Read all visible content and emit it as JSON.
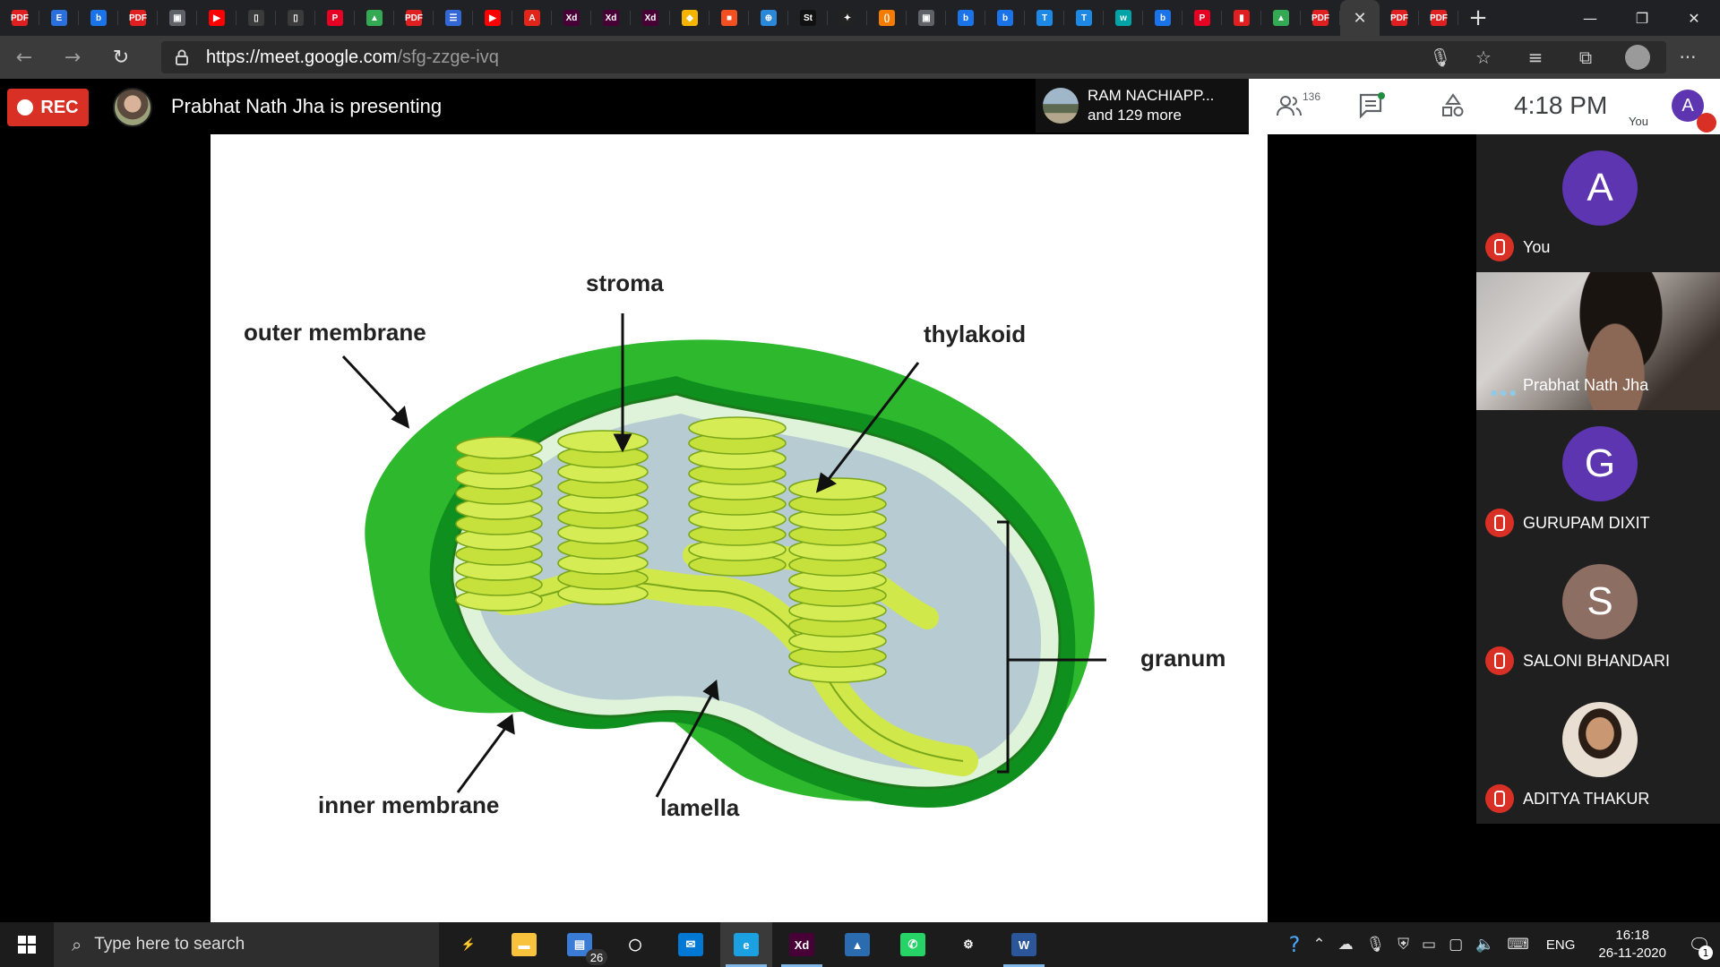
{
  "browser": {
    "tab_favicons": [
      {
        "icon": "pdf-icon",
        "color": "#e02020",
        "glyph": "PDF"
      },
      {
        "icon": "edge-e-icon",
        "color": "#2a6fdb",
        "glyph": "E"
      },
      {
        "icon": "bing-icon",
        "color": "#1a73e8",
        "glyph": "b"
      },
      {
        "icon": "pdf-icon",
        "color": "#e02020",
        "glyph": "PDF"
      },
      {
        "icon": "contact-card-icon",
        "color": "#5f6368",
        "glyph": "▣"
      },
      {
        "icon": "youtube-icon",
        "color": "#ff0000",
        "glyph": "▶"
      },
      {
        "icon": "document-icon",
        "color": "#3b3b3b",
        "glyph": "▯"
      },
      {
        "icon": "document-icon",
        "color": "#3b3b3b",
        "glyph": "▯"
      },
      {
        "icon": "pinterest-icon",
        "color": "#e60023",
        "glyph": "P"
      },
      {
        "icon": "google-drive-icon",
        "color": "#34a853",
        "glyph": "▲"
      },
      {
        "icon": "pdf-icon",
        "color": "#e02020",
        "glyph": "PDF"
      },
      {
        "icon": "forms-icon",
        "color": "#3367d6",
        "glyph": "☰"
      },
      {
        "icon": "youtube-icon",
        "color": "#ff0000",
        "glyph": "▶"
      },
      {
        "icon": "adobe-icon",
        "color": "#e1251b",
        "glyph": "A"
      },
      {
        "icon": "adobe-xd-icon",
        "color": "#470137",
        "glyph": "Xd"
      },
      {
        "icon": "adobe-xd-icon",
        "color": "#470137",
        "glyph": "Xd"
      },
      {
        "icon": "adobe-xd-icon",
        "color": "#470137",
        "glyph": "Xd"
      },
      {
        "icon": "layers-icon",
        "color": "#f4b400",
        "glyph": "◆"
      },
      {
        "icon": "microsoft-icon",
        "color": "#f25022",
        "glyph": "■"
      },
      {
        "icon": "teams-icon",
        "color": "#2b88d8",
        "glyph": "⊕"
      },
      {
        "icon": "st-icon",
        "color": "#111111",
        "glyph": "St"
      },
      {
        "icon": "spark-icon",
        "color": "#222222",
        "glyph": "✦"
      },
      {
        "icon": "script-icon",
        "color": "#f57c00",
        "glyph": "()"
      },
      {
        "icon": "contact-card-icon",
        "color": "#5f6368",
        "glyph": "▣"
      },
      {
        "icon": "bing-icon",
        "color": "#1a73e8",
        "glyph": "b"
      },
      {
        "icon": "bing-icon",
        "color": "#1a73e8",
        "glyph": "b"
      },
      {
        "icon": "tez-icon",
        "color": "#1e88e5",
        "glyph": "T"
      },
      {
        "icon": "tez-icon",
        "color": "#1e88e5",
        "glyph": "T"
      },
      {
        "icon": "w-icon",
        "color": "#00a4a6",
        "glyph": "w"
      },
      {
        "icon": "bing-icon",
        "color": "#1a73e8",
        "glyph": "b"
      },
      {
        "icon": "pinterest-icon",
        "color": "#e60023",
        "glyph": "P"
      },
      {
        "icon": "pdf-icon",
        "color": "#e02020",
        "glyph": "▮"
      },
      {
        "icon": "google-drive-icon",
        "color": "#34a853",
        "glyph": "▲"
      },
      {
        "icon": "pdf-icon",
        "color": "#e02020",
        "glyph": "PDF"
      }
    ],
    "tab_favicons_after": [
      {
        "icon": "pdf-icon",
        "color": "#e02020",
        "glyph": "PDF"
      },
      {
        "icon": "pdf-icon",
        "color": "#e02020",
        "glyph": "PDF"
      }
    ],
    "active_tab_close": "✕",
    "new_tab_glyph": "+",
    "window_controls": {
      "minimize": "—",
      "restore": "❐",
      "close": "✕"
    },
    "url": {
      "host": "https://meet.google.com",
      "path": "/sfg-zzge-ivq"
    }
  },
  "meet": {
    "rec_label": "REC",
    "presenting_text": "Prabhat Nath Jha is presenting",
    "participant_chip": {
      "line1": "RAM NACHIAPP...",
      "line2": "and 129 more"
    },
    "people_count": "136",
    "clock": "4:18 PM",
    "you_initial": "A",
    "you_label": "You",
    "accent_color": "#5e35b1",
    "rec_color": "#d93025"
  },
  "slide": {
    "labels": {
      "stroma": "stroma",
      "outer_membrane": "outer membrane",
      "thylakoid": "thylakoid",
      "granum": "granum",
      "inner_membrane": "inner membrane",
      "lamella": "lamella"
    }
  },
  "participants": [
    {
      "name": "You",
      "initial": "A",
      "color": "#5e35b1",
      "muted": true
    },
    {
      "name": "Prabhat Nath Jha",
      "video": true,
      "speaking": true
    },
    {
      "name": "GURUPAM DIXIT",
      "initial": "G",
      "color": "#5e35b1",
      "muted": true
    },
    {
      "name": "SALONI BHANDARI",
      "initial": "S",
      "color": "#8d6e63",
      "muted": true
    },
    {
      "name": "ADITYA THAKUR",
      "photo": true,
      "muted": true
    }
  ],
  "taskbar": {
    "search_placeholder": "Type here to search",
    "apps": [
      {
        "icon": "spark-app-icon",
        "color": "#1c1c1c",
        "glyph": "⚡",
        "running": false
      },
      {
        "icon": "file-explorer-icon",
        "color": "#f9c23c",
        "glyph": "▬",
        "running": false
      },
      {
        "icon": "store-icon",
        "color": "#3a7bd5",
        "glyph": "▤",
        "running": false,
        "badge": "26"
      },
      {
        "icon": "cortana-icon",
        "color": "#1c1c1c",
        "glyph": "◯",
        "running": false
      },
      {
        "icon": "mail-icon",
        "color": "#0078d4",
        "glyph": "✉",
        "running": false
      },
      {
        "icon": "edge-icon",
        "color": "#1ba1e2",
        "glyph": "e",
        "running": true,
        "active": true
      },
      {
        "icon": "adobe-xd-icon",
        "color": "#470137",
        "glyph": "Xd",
        "running": true
      },
      {
        "icon": "photos-icon",
        "color": "#2b6cb0",
        "glyph": "▲",
        "running": false
      },
      {
        "icon": "whatsapp-icon",
        "color": "#25d366",
        "glyph": "✆",
        "running": false
      },
      {
        "icon": "settings-icon",
        "color": "#1c1c1c",
        "glyph": "⚙",
        "running": false
      },
      {
        "icon": "word-icon",
        "color": "#2b579a",
        "glyph": "W",
        "running": true
      }
    ],
    "lang": "ENG",
    "time": "16:18",
    "date": "26-11-2020",
    "notification_count": "1"
  }
}
